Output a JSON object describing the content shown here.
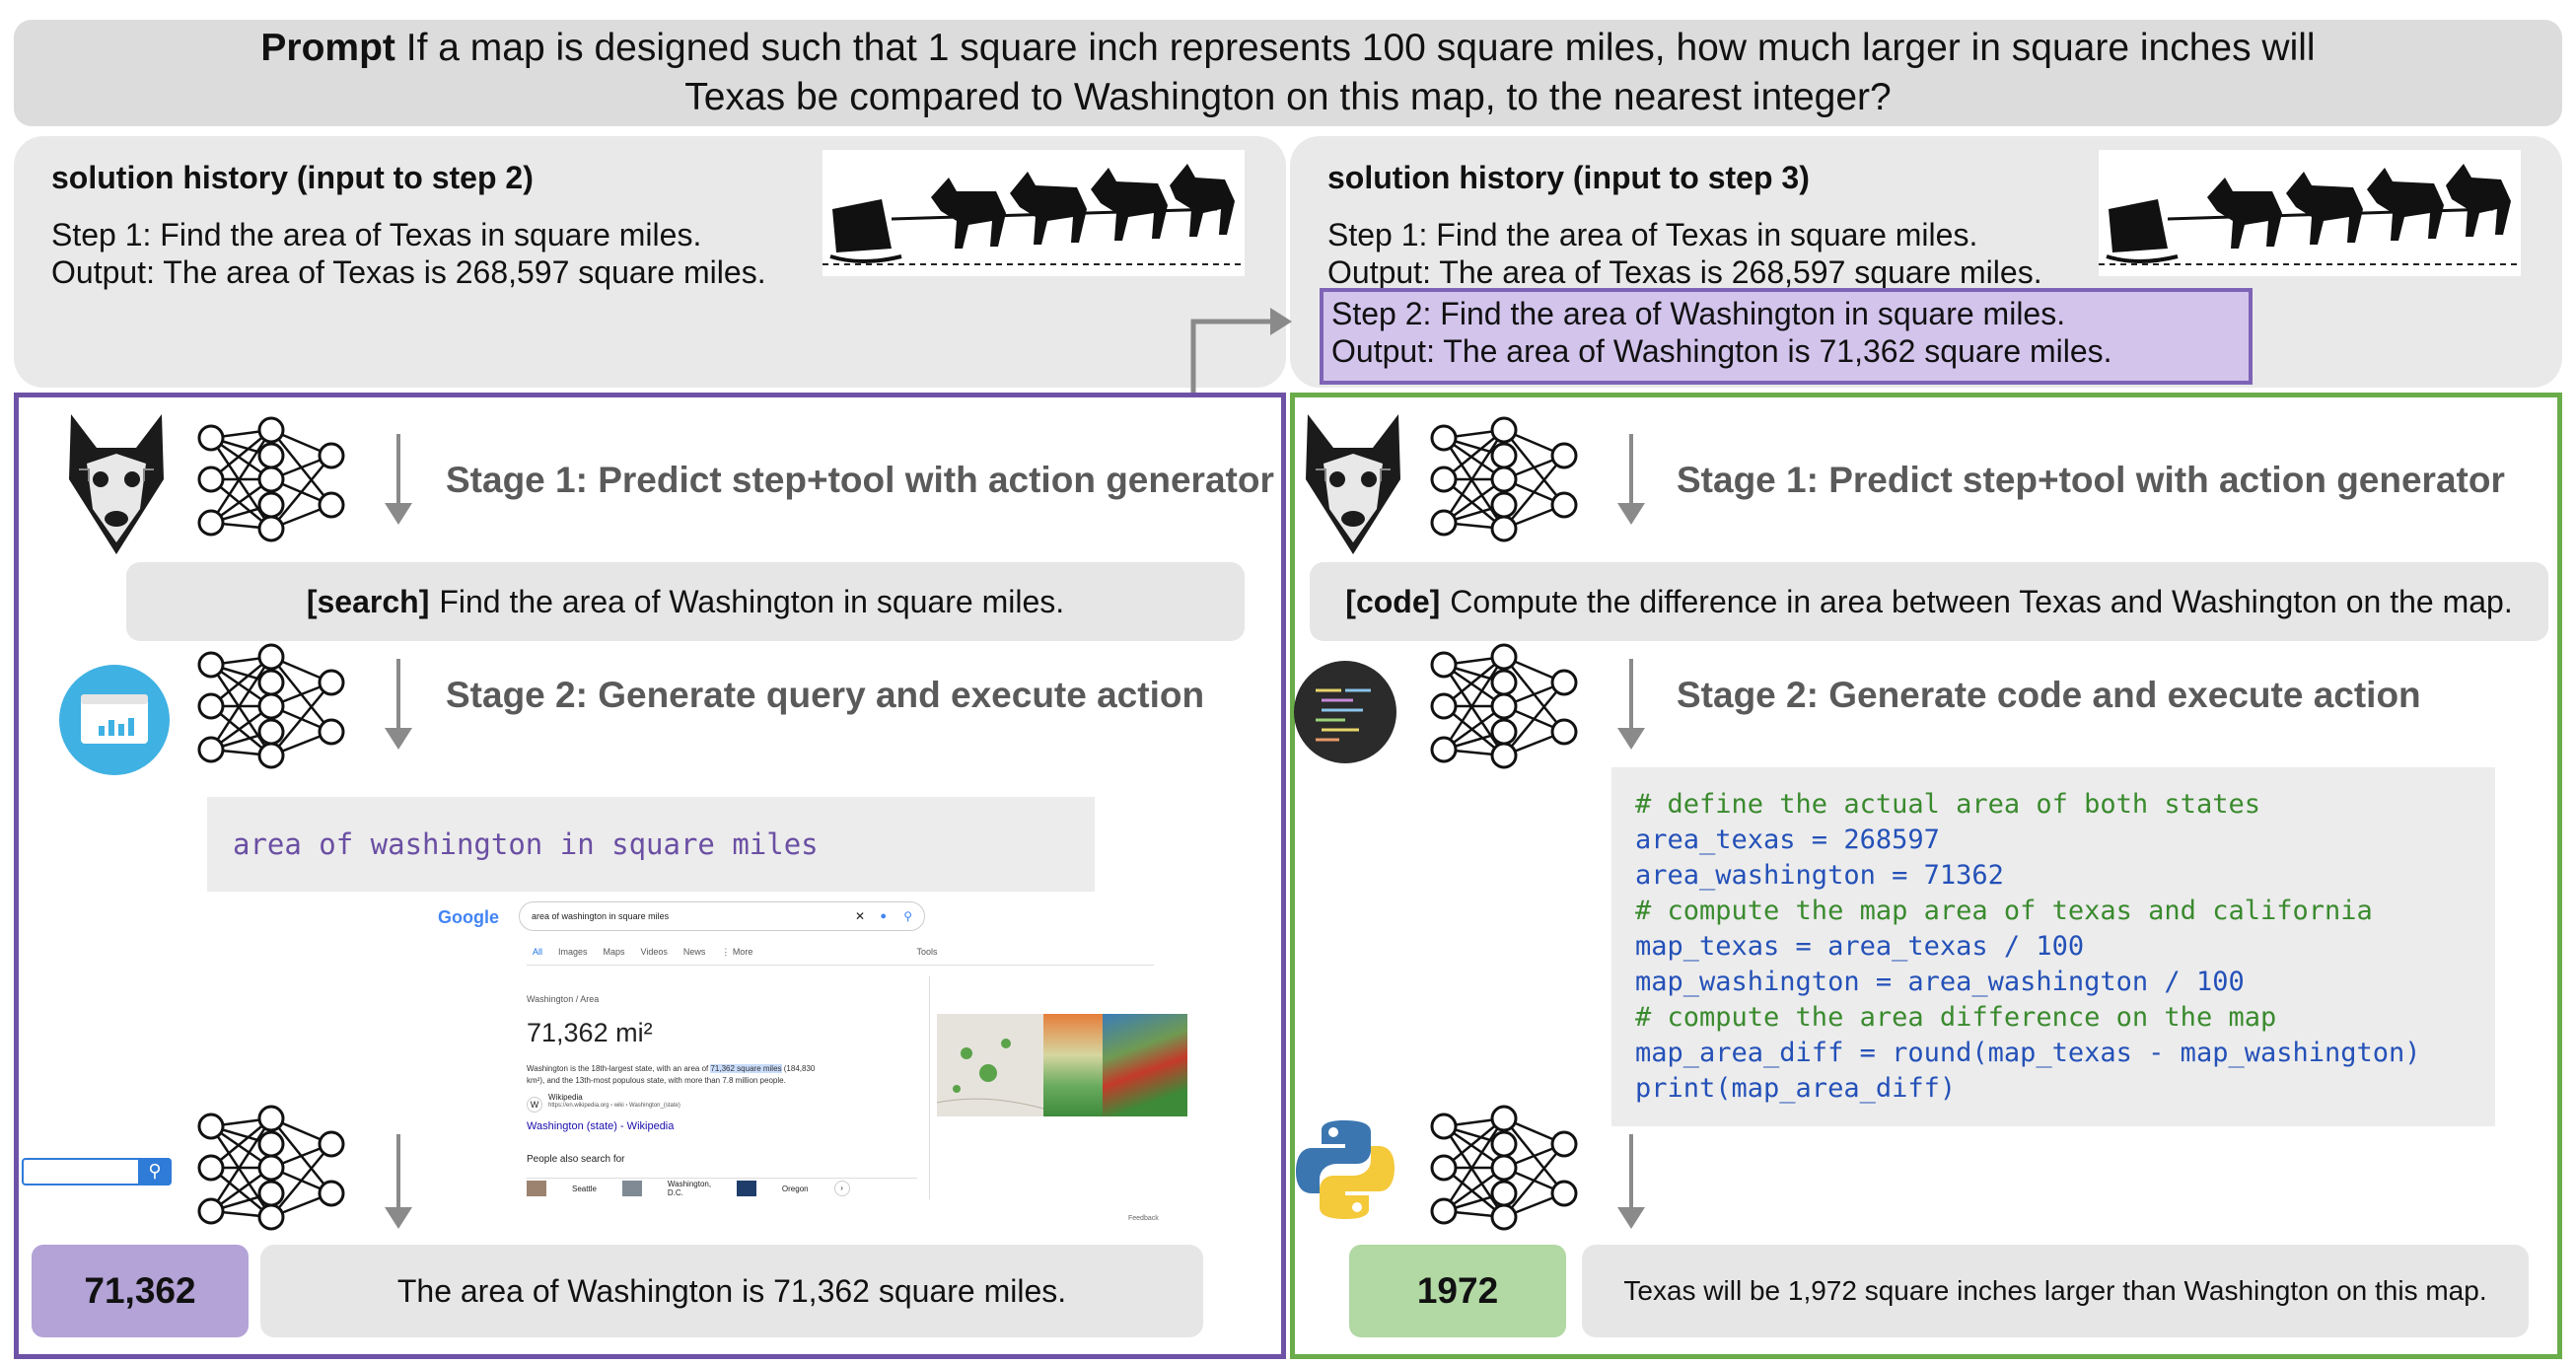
{
  "prompt": {
    "label": "Prompt",
    "line1": "If a map is designed such that 1 square inch represents 100 square miles, how much larger in square inches will",
    "line2": "Texas be compared to Washington on this map, to the nearest integer?"
  },
  "left_history": {
    "title": "solution history (input to step 2)",
    "step1": "Step 1: Find the area of Texas in square miles.",
    "output1": "Output: The area of Texas is 268,597 square miles."
  },
  "right_history": {
    "title": "solution history (input to step 3)",
    "step1": "Step 1: Find the area of Texas in square miles.",
    "output1": "Output: The area of Texas is 268,597 square miles.",
    "step2": "Step 2: Find the area of Washington in square miles.",
    "output2": "Output: The area of Washington is 71,362 square miles."
  },
  "left": {
    "stage1": "Stage 1: Predict step+tool with action generator",
    "action_tag": "[search]",
    "action_text": "Find the area of Washington in square miles.",
    "stage2": "Stage 2: Generate query and execute action",
    "query": "area of washington in square miles",
    "result_value": "71,362",
    "result_text": "The area of Washington is 71,362 square miles.",
    "search": {
      "brand": "Google",
      "query": "area of washington in square miles",
      "tabs": [
        "All",
        "Images",
        "Maps",
        "Videos",
        "News",
        "⋮ More",
        "Tools"
      ],
      "breadcrumb": "Washington / Area",
      "answer": "71,362 mi²",
      "snippet1": "Washington is the 18th-largest state, with an area of",
      "snippet_hl": "71,362 square miles",
      "snippet2": "(184,830 km²), and the 13th-most populous state, with more than 7.8 million people.",
      "src_name": "Wikipedia",
      "src_url": "https://en.wikipedia.org › wiki › Washington_(state)",
      "src_link": "Washington (state) - Wikipedia",
      "also": "People also search for",
      "also_items": [
        "Seattle",
        "Washington, D.C.",
        "Oregon"
      ],
      "feedback": "Feedback"
    }
  },
  "right": {
    "stage1": "Stage 1: Predict step+tool with action generator",
    "action_tag": "[code]",
    "action_text": "Compute the difference in area between Texas and Washington on the map.",
    "stage2": "Stage 2: Generate code and execute action",
    "code": [
      "# define the actual area of both states",
      "area_texas = 268597",
      "area_washington = 71362",
      "# compute the map area of texas and california",
      "map_texas = area_texas / 100",
      "map_washington = area_washington / 100",
      "# compute the area difference on the map",
      "map_area_diff = round(map_texas - map_washington)",
      "print(map_area_diff)"
    ],
    "result_value": "1972",
    "result_text": "Texas will be 1,972 square inches larger than Washington on this map."
  },
  "colors": {
    "purple": "#6e52a6",
    "purple_fill": "#b3a3d6",
    "green": "#6aac4a",
    "green_fill": "#b2d8a4",
    "query_text": "#6a4fa3",
    "code_comment": "#3a8a2e",
    "code_text": "#2451b8"
  }
}
